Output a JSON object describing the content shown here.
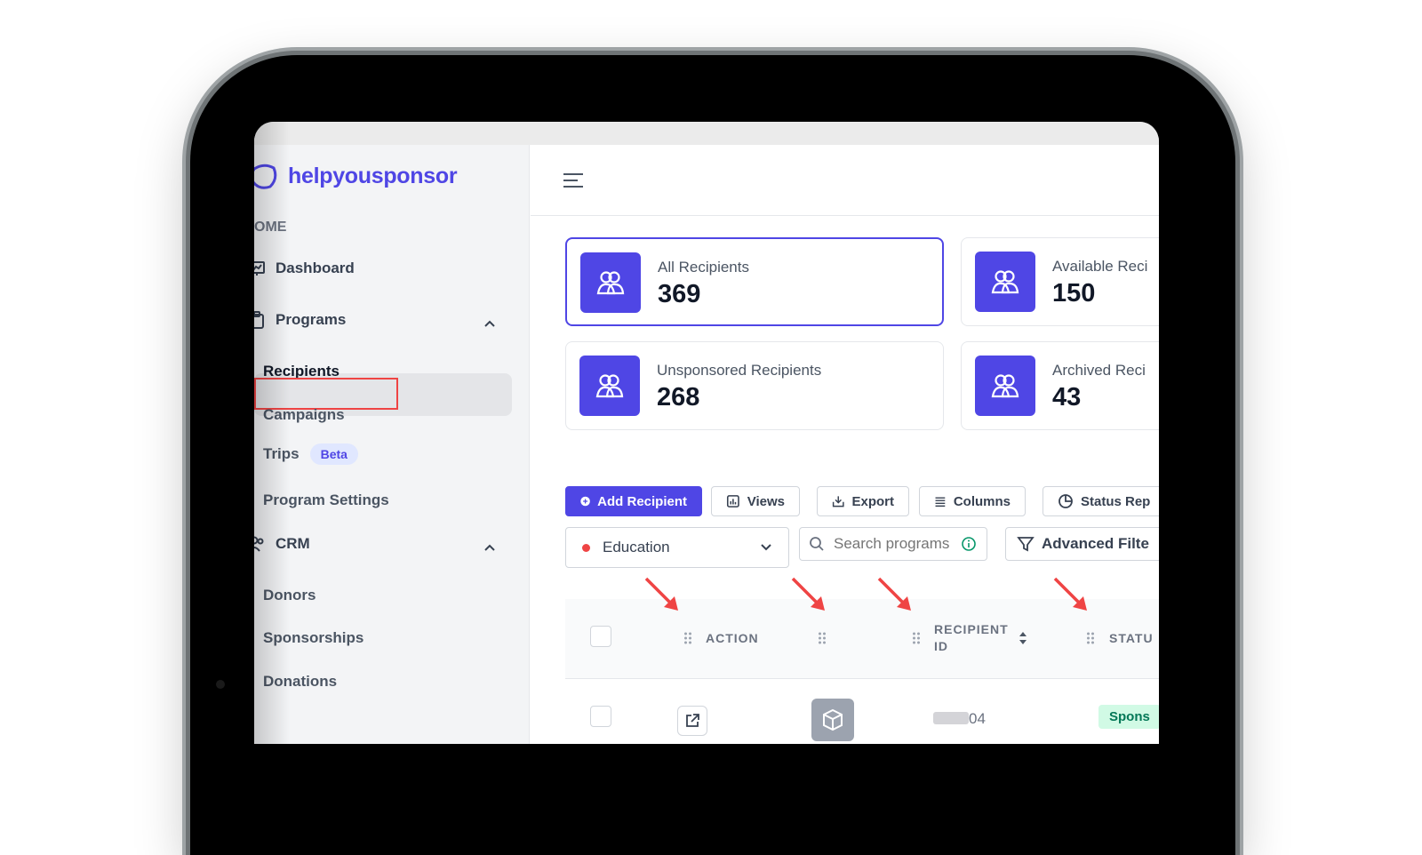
{
  "brand": {
    "name": "helpyousponsor",
    "color": "#4f46e5"
  },
  "sidebar": {
    "section_label": "OME",
    "dashboard": "Dashboard",
    "programs": "Programs",
    "program_items": [
      {
        "label": "Recipients",
        "active": true
      },
      {
        "label": "Campaigns"
      },
      {
        "label": "Trips",
        "badge": "Beta"
      },
      {
        "label": "Program Settings"
      }
    ],
    "crm": "CRM",
    "crm_items": [
      {
        "label": "Donors"
      },
      {
        "label": "Sponsorships"
      },
      {
        "label": "Donations"
      }
    ]
  },
  "stats": [
    {
      "label": "All Recipients",
      "value": "369",
      "active": true
    },
    {
      "label": "Available Reci",
      "value": "150"
    },
    {
      "label": "Unsponsored Recipients",
      "value": "268"
    },
    {
      "label": "Archived Reci",
      "value": "43"
    }
  ],
  "toolbar": {
    "add": "Add Recipient",
    "views": "Views",
    "export": "Export",
    "columns": "Columns",
    "status_report": "Status Rep"
  },
  "filters": {
    "program": "Education",
    "search_placeholder": "Search programs",
    "advanced": "Advanced Filte"
  },
  "table": {
    "headers": {
      "action": "ACTION",
      "recipient_id_1": "RECIPIENT",
      "recipient_id_2": "ID",
      "status": "STATU"
    },
    "row": {
      "id_suffix": "04",
      "status": "Spons"
    }
  },
  "colors": {
    "accent": "#4f46e5",
    "annotation": "#ef4444",
    "status_green": "#047857"
  }
}
